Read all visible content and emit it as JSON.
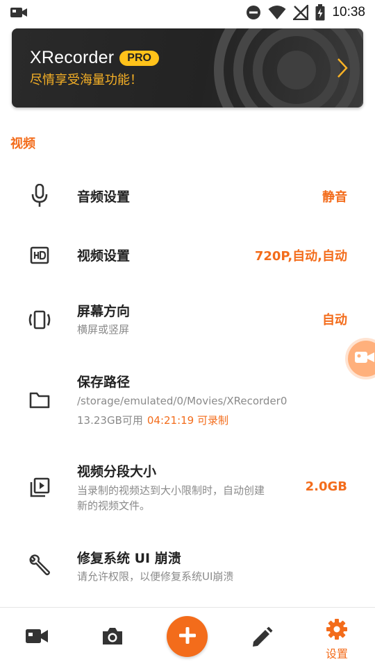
{
  "status_bar": {
    "time": "10:38",
    "icons": [
      "video-camera-icon",
      "do-not-disturb-icon",
      "wifi-icon",
      "no-signal-icon",
      "battery-charging-icon"
    ]
  },
  "promo": {
    "brand": "XRecorder",
    "badge": "PRO",
    "subtitle": "尽情享受海量功能！",
    "icons": [
      "chevron-right-icon"
    ]
  },
  "section": {
    "title": "视频"
  },
  "settings": [
    {
      "key": "audio",
      "icon": "microphone-icon",
      "title": "音频设置",
      "value": "静音"
    },
    {
      "key": "video",
      "icon": "hd-icon",
      "title": "视频设置",
      "value": "720P,自动,自动"
    },
    {
      "key": "orientation",
      "icon": "screen-rotation-icon",
      "title": "屏幕方向",
      "subtitle": "横屏或竖屏",
      "value": "自动"
    },
    {
      "key": "save_path",
      "icon": "folder-icon",
      "title": "保存路径",
      "subtitle": "/storage/emulated/0/Movies/XRecorder0",
      "storage": "13.23GB可用",
      "record_time": "04:21:19 可录制"
    },
    {
      "key": "segment",
      "icon": "video-library-icon",
      "title": "视频分段大小",
      "subtitle_line1": "当录制的视频达到大小限制时，自动创建",
      "subtitle_line2": "新的视频文件。",
      "value": "2.0GB"
    },
    {
      "key": "fix_ui",
      "icon": "wrench-icon",
      "title": "修复系统 UI 崩溃",
      "subtitle": "请允许权限，以便修复系统UI崩溃"
    }
  ],
  "floating_bubble": {
    "icon": "video-camera-icon"
  },
  "bottom_nav": {
    "items": [
      {
        "icon": "video-camera-icon",
        "label": ""
      },
      {
        "icon": "camera-icon",
        "label": ""
      },
      {
        "icon": "plus-icon",
        "label": ""
      },
      {
        "icon": "pencil-icon",
        "label": ""
      },
      {
        "icon": "gear-icon",
        "label": "设置"
      }
    ]
  },
  "colors": {
    "accent": "#f36c1b",
    "badge": "#ffc21a",
    "banner_bg": "#2a2a2a",
    "muted_text": "#8a8a8a"
  }
}
